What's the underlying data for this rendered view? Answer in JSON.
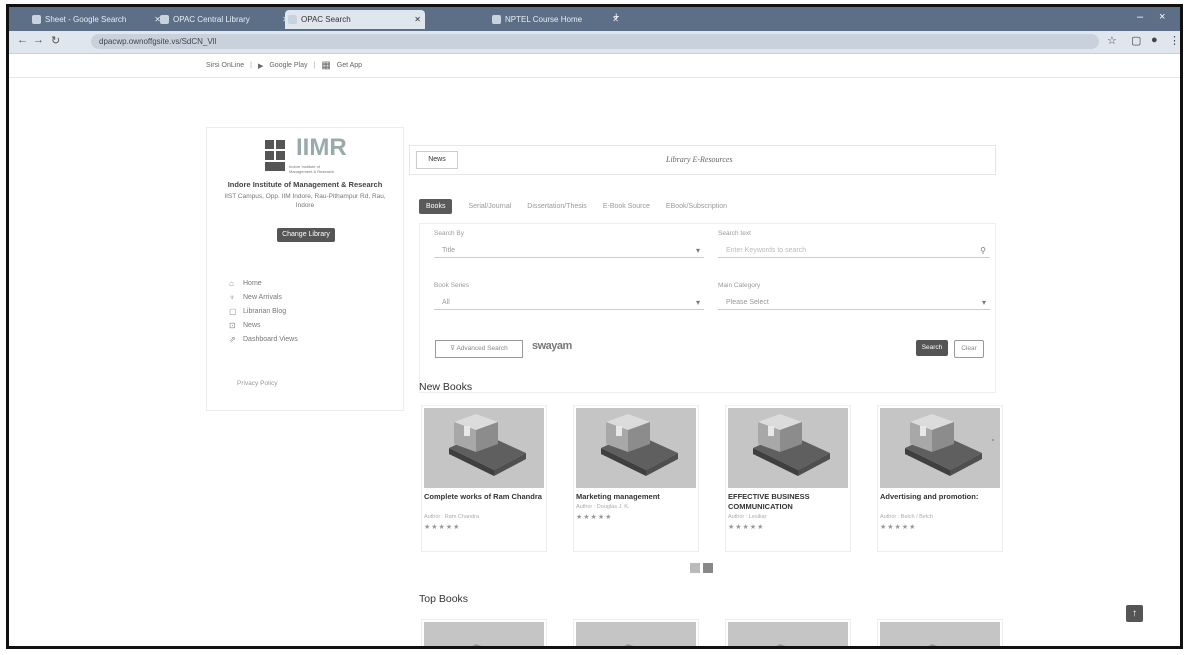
{
  "browser": {
    "tabs": [
      {
        "label": "Sheet - Google Search"
      },
      {
        "label": "OPAC Central Library"
      },
      {
        "label": "OPAC Search"
      },
      {
        "label": "NPTEL Course Home"
      }
    ],
    "url": "dpacwp.ownoffgsite.vs/SdCN_Vll",
    "window_controls": [
      "–",
      "×"
    ]
  },
  "toplinks": {
    "item1": "Sirsi OnLine",
    "item2": "Google Play",
    "item3": "Get App"
  },
  "sidebar": {
    "logo_text": "IIMR",
    "logo_sub": "Indore Institute of Management & Research",
    "institute_name": "Indore Institute of Management & Research",
    "address": "IIST Campus, Opp. IIM Indore, Rau-Pithampur Rd, Rau, Indore",
    "change_library": "Change Library",
    "menu": [
      {
        "label": "Home",
        "icon": "home-icon"
      },
      {
        "label": "New Arrivals",
        "icon": "arrival-icon"
      },
      {
        "label": "Librarian Blog",
        "icon": "blog-icon"
      },
      {
        "label": "News",
        "icon": "news-icon"
      },
      {
        "label": "Dashboard Views",
        "icon": "dashboard-icon"
      }
    ],
    "privacy": "Privacy Policy"
  },
  "news": {
    "label": "News",
    "text": "Library E-Resources"
  },
  "tabs": {
    "books": "Books",
    "serial": "Serial/Journal",
    "dissertation": "Dissertation/Thesis",
    "ebook": "E-Book Source",
    "ebook_sub": "EBook/Subscription"
  },
  "form": {
    "search_by_label": "Search By",
    "search_by_value": "Title",
    "search_text_label": "Search text",
    "search_text_placeholder": "Enter Keywords to search",
    "book_series_label": "Book Series",
    "book_series_value": "All",
    "main_category_label": "Main Category",
    "main_category_value": "Please Select",
    "advanced_search": "Advanced Search",
    "swayam": "swayam",
    "search_button": "Search",
    "clear_button": "Clear"
  },
  "new_books": {
    "heading": "New Books",
    "items": [
      {
        "title": "Complete works of Ram Chandra",
        "author": "Author : Ram Chandra",
        "stars": "★★★★★"
      },
      {
        "title": "Marketing management",
        "author": "Author : Douglas J. K.",
        "stars": "★★★★★"
      },
      {
        "title": "EFFECTIVE BUSINESS COMMUNICATION",
        "author": "Author : Lesikar",
        "stars": "★★★★★"
      },
      {
        "title": "Advertising and promotion:",
        "author": "Author : Belch / Belch",
        "stars": "★★★★★"
      }
    ]
  },
  "top_books": {
    "heading": "Top Books"
  },
  "scroll_top": "↑"
}
